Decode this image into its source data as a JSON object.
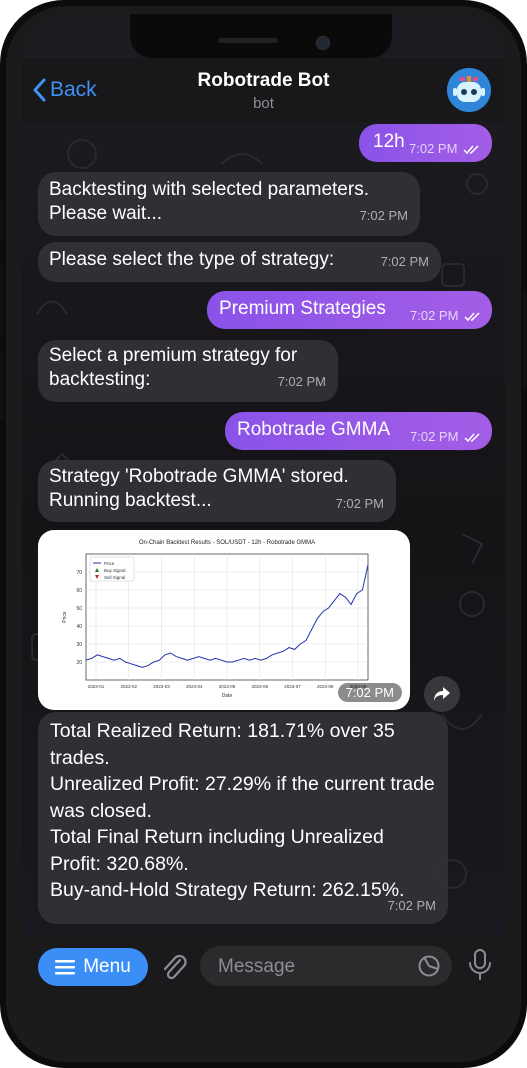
{
  "header": {
    "back_label": "Back",
    "title": "Robotrade Bot",
    "subtitle": "bot"
  },
  "messages": [
    {
      "dir": "out",
      "text": "12h",
      "time": "7:02 PM"
    },
    {
      "dir": "in",
      "text": "Backtesting with selected parameters. Please wait...",
      "time": "7:02 PM"
    },
    {
      "dir": "in",
      "text": "Please select the type of strategy:",
      "time": "7:02 PM"
    },
    {
      "dir": "out",
      "text": "Premium Strategies",
      "time": "7:02 PM"
    },
    {
      "dir": "in",
      "text": "Select a premium strategy for backtesting:",
      "time": "7:02 PM"
    },
    {
      "dir": "out",
      "text": "Robotrade GMMA",
      "time": "7:02 PM"
    },
    {
      "dir": "in",
      "text": "Strategy 'Robotrade GMMA' stored. Running backtest...",
      "time": "7:02 PM"
    },
    {
      "dir": "in",
      "text": "Total Realized Return: 181.71% over 35 trades.\nUnrealized Profit: 27.29% if the current trade was closed.\nTotal Final Return including Unrealized Profit: 320.68%.\nBuy-and-Hold Strategy Return: 262.15%.",
      "time": "7:02 PM"
    }
  ],
  "image_message": {
    "time": "7:02 PM"
  },
  "chart_data": {
    "type": "line",
    "title": "On-Chain Backtest Results - SOL/USDT - 12h - Robotrade GMMA",
    "xlabel": "Date",
    "ylabel": "Price",
    "legend": [
      "Price",
      "Buy Signal",
      "Sell Signal"
    ],
    "legend_position": "top-left",
    "grid": true,
    "ylim": [
      10,
      80
    ],
    "yticks": [
      20,
      30,
      40,
      50,
      60,
      70
    ],
    "xticks": [
      "2023-01",
      "2023-02",
      "2023-03",
      "2023-04",
      "2023-05",
      "2023-06",
      "2023-07",
      "2023-08",
      "2023-09"
    ],
    "series": [
      {
        "name": "Price",
        "x": [
          0,
          2,
          4,
          6,
          8,
          10,
          12,
          14,
          16,
          18,
          20,
          22,
          24,
          26,
          28,
          30,
          32,
          34,
          36,
          38,
          40,
          42,
          44,
          46,
          48,
          50,
          52,
          54,
          56,
          58,
          60,
          62,
          64,
          66,
          68,
          70,
          72,
          74,
          76,
          78,
          80,
          82,
          84,
          86,
          88,
          90,
          92,
          94,
          96,
          98,
          100
        ],
        "values": [
          21,
          22,
          24,
          23,
          22,
          21,
          22,
          20,
          19,
          18,
          17,
          18,
          20,
          21,
          24,
          25,
          23,
          22,
          21,
          22,
          23,
          22,
          21,
          22,
          21,
          20,
          20,
          21,
          22,
          21,
          22,
          21,
          22,
          24,
          25,
          26,
          28,
          27,
          30,
          32,
          38,
          44,
          48,
          50,
          54,
          58,
          56,
          52,
          58,
          60,
          74
        ]
      }
    ]
  },
  "bottom_bar": {
    "menu_label": "Menu",
    "input_placeholder": "Message"
  }
}
